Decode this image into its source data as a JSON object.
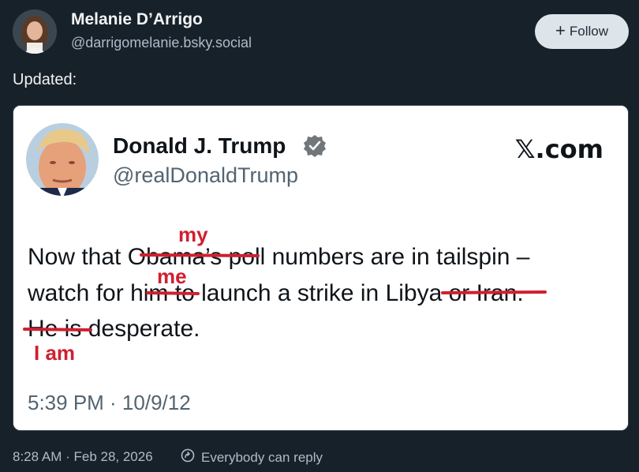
{
  "post": {
    "author_name": "Melanie D’Arrigo",
    "author_handle": "@darrigomelanie.bsky.social",
    "follow_label": "Follow",
    "text": "Updated:",
    "timestamp": "8:28 AM · Feb 28, 2026",
    "reply_setting": "Everybody can reply"
  },
  "embedded_tweet": {
    "name": "Donald J. Trump",
    "handle": "@realDonaldTrump",
    "site_logo": "𝕏.com",
    "line1_a": "Now that ",
    "line1_struck": "Obama’s",
    "line1_b": " poll numbers are in tailspin –",
    "line2_a": "watch for ",
    "line2_struck1": "him",
    "line2_b": " to launch a strike in ",
    "line2_struck2": "Libya or",
    "line2_c": " Iran.",
    "line3_struck": "He is",
    "line3_a": " desperate.",
    "edit_my": "my",
    "edit_me": "me",
    "edit_i_am": "I am",
    "timestamp": "5:39 PM · 10/9/12"
  },
  "colors": {
    "background": "#172129",
    "edit_red": "#d01f2f",
    "verified": "#71767b"
  },
  "icons": {
    "plus": "plus-icon",
    "verified": "verified-badge-icon",
    "reply": "reply-settings-icon"
  }
}
